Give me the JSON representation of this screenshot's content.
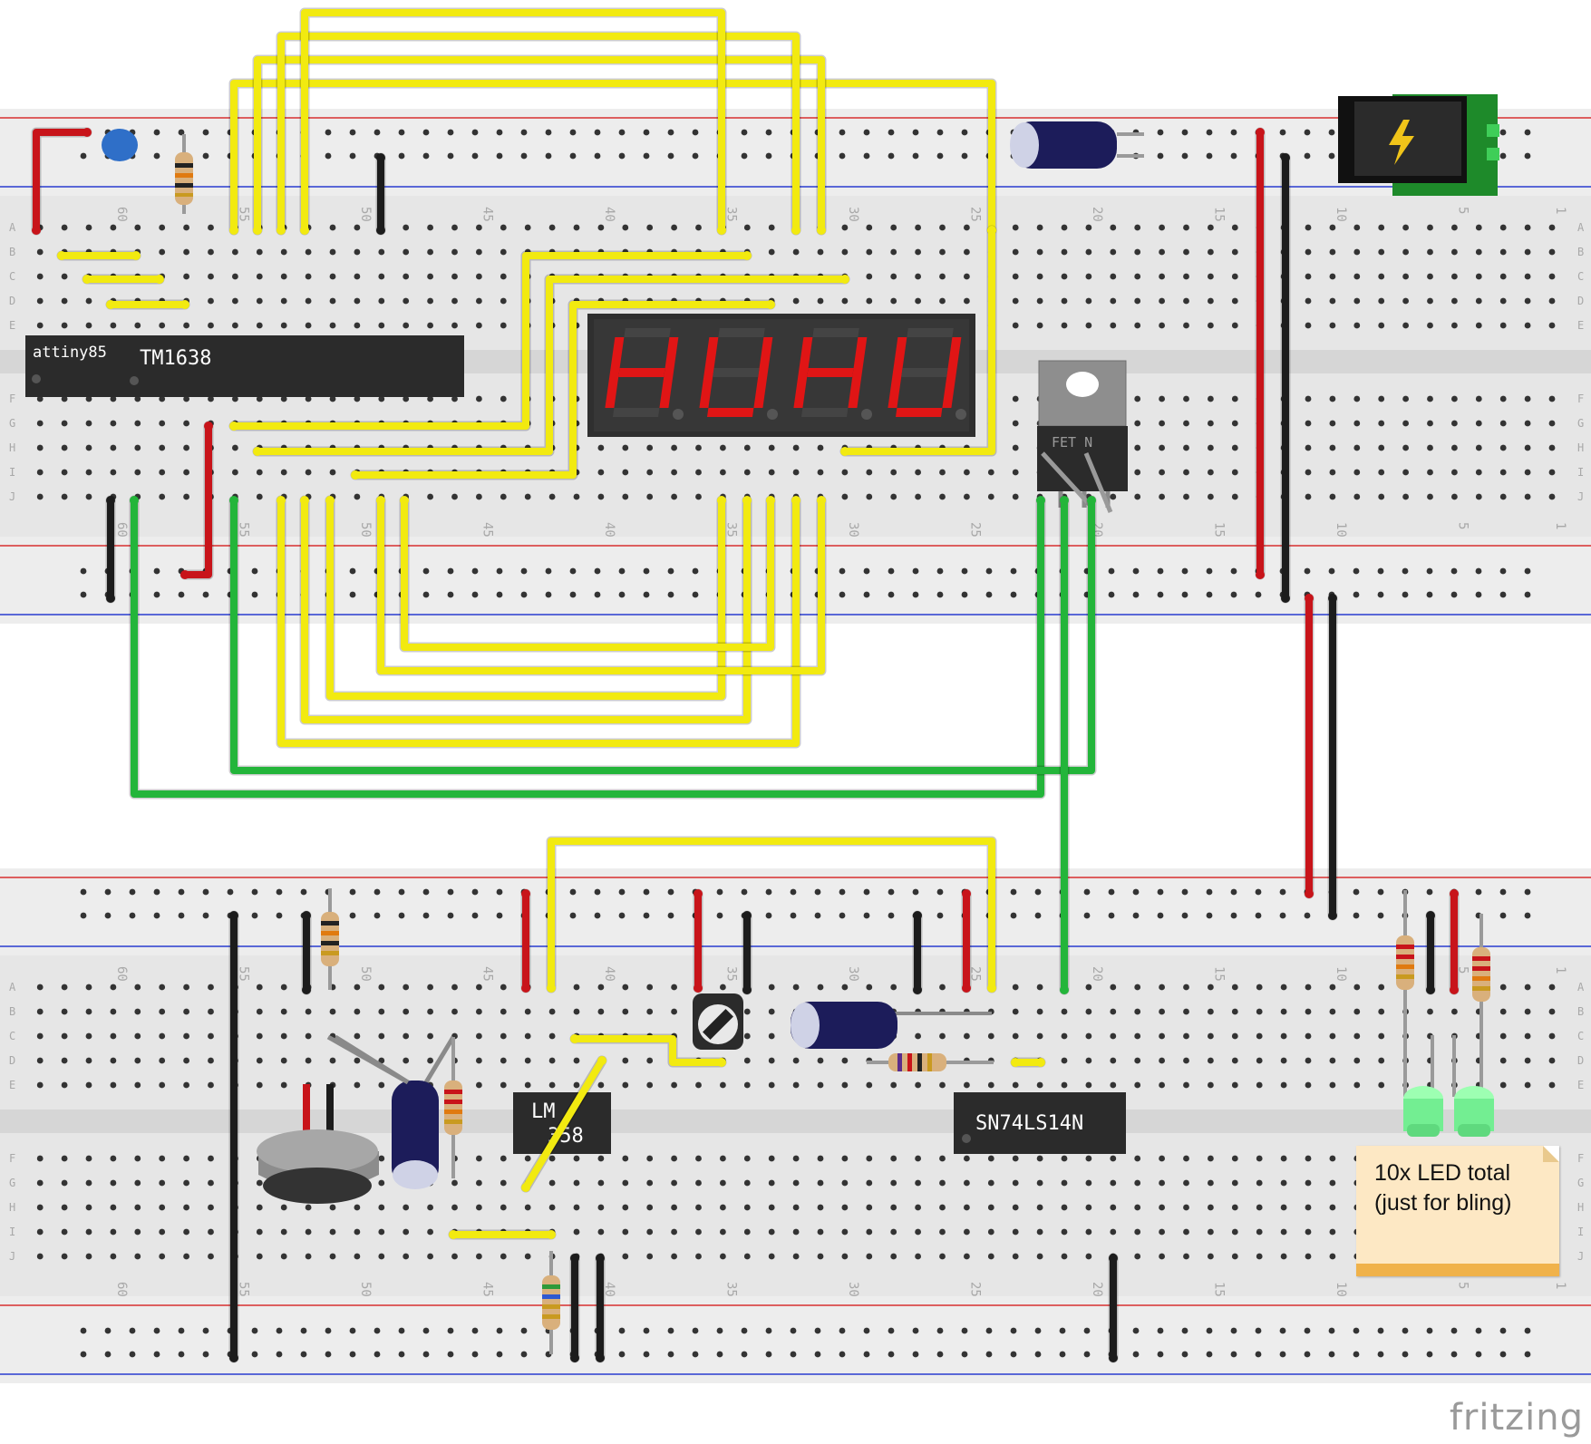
{
  "board_labels": {
    "chip_attiny": "attiny85",
    "chip_tm1638": "TM1638",
    "chip_lm358_a": "LM",
    "chip_lm358_b": "358",
    "chip_sn74": "SN74LS14N",
    "fet_label": "FET N"
  },
  "display": {
    "digits": [
      "H",
      "U",
      "H",
      "U"
    ],
    "segment_color": "#e01515"
  },
  "column_numbers": [
    "60",
    "55",
    "50",
    "45",
    "40",
    "35",
    "30",
    "25",
    "20",
    "15",
    "10",
    "5",
    "1"
  ],
  "row_letters_top": [
    "A",
    "B",
    "C",
    "D",
    "E"
  ],
  "row_letters_bottom": [
    "F",
    "G",
    "H",
    "I",
    "J"
  ],
  "note": {
    "line1": "10x LED total",
    "line2": "(just for bling)"
  },
  "brand": "fritzing",
  "colors": {
    "wire_yellow": "#f2ea10",
    "wire_green": "#23b53a",
    "wire_red": "#c8141a",
    "wire_black": "#1c1c1c",
    "breadboard": "#e6e6e6",
    "rail_red": "#d83030",
    "rail_blue": "#2a3cd0",
    "chip": "#2b2b2b",
    "note_bg": "#fde8c4"
  }
}
